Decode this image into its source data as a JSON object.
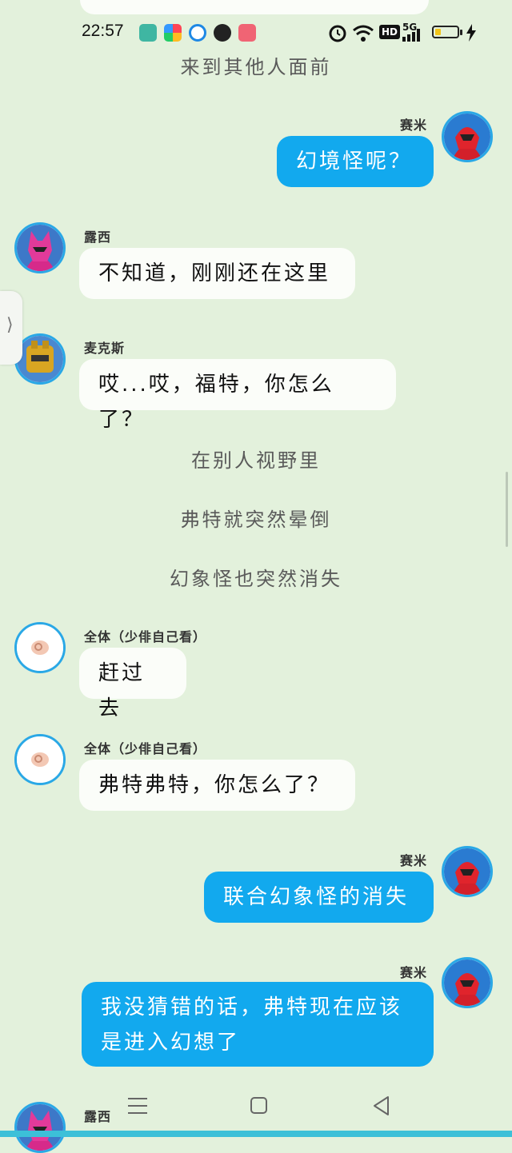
{
  "status_bar": {
    "time": "22:57",
    "signal_label": "5G",
    "hd_label": "HD",
    "battery_level": 0.25,
    "icons": [
      "wifi-icon",
      "alarm-icon",
      "signal-icon",
      "battery-icon",
      "charging-icon"
    ]
  },
  "narration": [
    "来到其他人面前",
    "在别人视野里",
    "弗特就突然晕倒",
    "幻象怪也突然消失"
  ],
  "messages": [
    {
      "side": "right",
      "name": "赛米",
      "text": "幻境怪呢？"
    },
    {
      "side": "left",
      "name": "露西",
      "text": "不知道，刚刚还在这里"
    },
    {
      "side": "left",
      "name": "麦克斯",
      "text": "哎...哎，福特，你怎么了？"
    },
    {
      "side": "left",
      "name": "全体（少俳自己看）",
      "text": "赶过去"
    },
    {
      "side": "left",
      "name": "全体（少俳自己看）",
      "text": "弗特弗特，你怎么了？"
    },
    {
      "side": "right",
      "name": "赛米",
      "text": "联合幻象怪的消失"
    },
    {
      "side": "right",
      "name": "赛米",
      "text": "我没猜错的话，弗特现在应该是进入幻想了"
    },
    {
      "side": "left",
      "name": "露西",
      "text": ""
    }
  ],
  "colors": {
    "background": "#e3f1dc",
    "outgoing_bubble": "#12a9ee",
    "incoming_bubble": "#fbfdf9",
    "avatar_border": "#2aa8e6"
  },
  "nav": {
    "menu_icon": "menu-icon",
    "home_icon": "home-icon",
    "back_icon": "back-icon"
  },
  "side_handle_glyph": "⟩"
}
